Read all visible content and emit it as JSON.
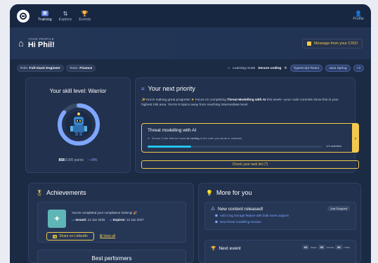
{
  "nav": {
    "items": [
      {
        "label": "Training",
        "icon": "training-icon"
      },
      {
        "label": "Explore",
        "icon": "explore-icon"
      },
      {
        "label": "Events",
        "icon": "trophy-icon"
      }
    ],
    "profile_label": "Profile"
  },
  "hero": {
    "eyebrow": "YOUR PROFILE",
    "title": "Hi Phil!",
    "ciso_button": "Message from your CISO"
  },
  "roles": {
    "role_label": "Role:",
    "role_value": "Full-stack Engineer",
    "team_label": "Team:",
    "team_value": "Finance",
    "learning_mode_label": "Learning mode",
    "learning_mode_value": "Secure coding",
    "languages": [
      "TypeScript React",
      "Java Spring",
      "+3"
    ]
  },
  "skill": {
    "title": "Your skill level: Warrior",
    "points": "858",
    "points_total": "/1000 points",
    "gain": "+8%",
    "progress": 0.858
  },
  "priority": {
    "title": "Your next priority",
    "text_a": "You're making great progress!",
    "text_b": "Focus on completing",
    "text_bold": "Threat Modelling with AI",
    "text_c": "this week—your code commits show this is your highest risk area. You're 6 topics away from reaching Intermediate level.",
    "module_title": "Threat modelling with AI",
    "module_desc_a": "Secure Code Warrior found",
    "module_desc_bold": "AI coding",
    "module_desc_b": "in the code you wrote or maintain.",
    "activities": "1/4 activities",
    "module_progress": 0.25,
    "tasks_button": "Check your task list (7)"
  },
  "achievements": {
    "title": "Achievements",
    "text": "You've completed your compliance training!",
    "issued_label": "Issued:",
    "issued": "12 Jan 2026",
    "expires_label": "Expires:",
    "expires": "12 Jan 2027",
    "linkedin": "Share on LinkedIn",
    "view_all": "View all",
    "best_title": "Best performers"
  },
  "more": {
    "title": "More for you",
    "new_content": "New content released!",
    "badge": "Just Dropped",
    "links": [
      "Add a log storage feature with bulk insert support",
      "New threat modelling mission"
    ],
    "next_event": "Next event",
    "countdown": [
      {
        "value": "04",
        "unit": "days"
      },
      {
        "value": "03",
        "unit": "hours"
      },
      {
        "value": "30",
        "unit": "mins"
      }
    ]
  },
  "colors": {
    "accent": "#f2c94c",
    "ring": "#7fa6ff",
    "bg": "#1c2b44"
  }
}
